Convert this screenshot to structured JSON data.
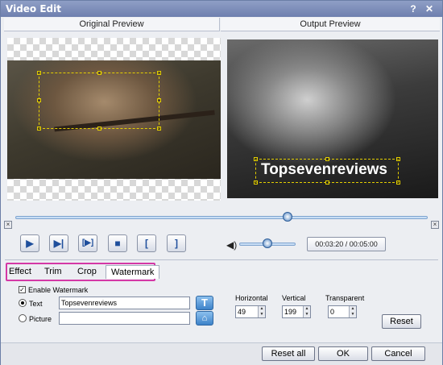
{
  "window": {
    "title": "Video Edit",
    "help_label": "?",
    "close_label": "✕"
  },
  "preview": {
    "original_label": "Original Preview",
    "output_label": "Output Preview",
    "watermark_overlay": "Topsevenreviews"
  },
  "playback": {
    "seek_position": 0.66,
    "volume_level": 0.5,
    "time_display": "00:03:20 / 00:05:00",
    "play_icon": "▶",
    "next_frame_icon": "▶|",
    "step_icon": "[▶]",
    "stop_icon": "■",
    "mark_in_icon": "[",
    "mark_out_icon": "]",
    "volume_icon": "◀)"
  },
  "tabs": [
    {
      "label": "Effect",
      "active": false
    },
    {
      "label": "Trim",
      "active": false
    },
    {
      "label": "Crop",
      "active": false
    },
    {
      "label": "Watermark",
      "active": true
    }
  ],
  "watermark": {
    "enable_label": "Enable Watermark",
    "enable_checked": true,
    "text_option_label": "Text",
    "picture_option_label": "Picture",
    "text_value": "Topsevenreviews",
    "picture_value": "",
    "text_format_icon": "T",
    "picture_browse_icon": "⌂",
    "horizontal_label": "Horizontal",
    "horizontal_value": "49",
    "vertical_label": "Vertical",
    "vertical_value": "199",
    "transparent_label": "Transparent",
    "transparent_value": "0",
    "reset_label": "Reset"
  },
  "footer": {
    "reset_all_label": "Reset all",
    "ok_label": "OK",
    "cancel_label": "Cancel"
  },
  "colors": {
    "titlebar": "#7485b4",
    "tab_highlight": "#d438a6",
    "watermark_box": "#e5d000",
    "slider": "#4e83c2"
  }
}
